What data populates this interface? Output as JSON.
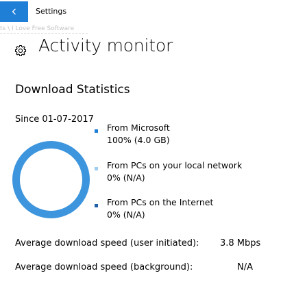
{
  "titlebar": {
    "app_title": "Settings",
    "back_icon": "back-arrow-icon",
    "accent_color": "#1f7ed6"
  },
  "watermark": "ts \\ I Love Free Software",
  "header": {
    "icon": "gear-icon",
    "title": "Activity monitor"
  },
  "section": {
    "title": "Download Statistics",
    "since": "Since 01-07-2017"
  },
  "legend": [
    {
      "label": "From Microsoft",
      "value": "100% (4.0 GB)",
      "color": "#1f7ed6"
    },
    {
      "label": "From PCs on your local network",
      "value": "0% (N/A)",
      "color": "#9fcdf0"
    },
    {
      "label": "From PCs on the Internet",
      "value": "0% (N/A)",
      "color": "#1f5fa8"
    }
  ],
  "chart_data": {
    "type": "pie",
    "categories": [
      "From Microsoft",
      "From PCs on your local network",
      "From PCs on the Internet"
    ],
    "values": [
      100,
      0,
      0
    ],
    "colors": [
      "#3d95dd",
      "#9fcdf0",
      "#1f5fa8"
    ],
    "donut": true
  },
  "stats": [
    {
      "label": "Average download speed (user initiated):",
      "value": "3.8 Mbps"
    },
    {
      "label": "Average download speed (background):",
      "value": "N/A"
    }
  ]
}
